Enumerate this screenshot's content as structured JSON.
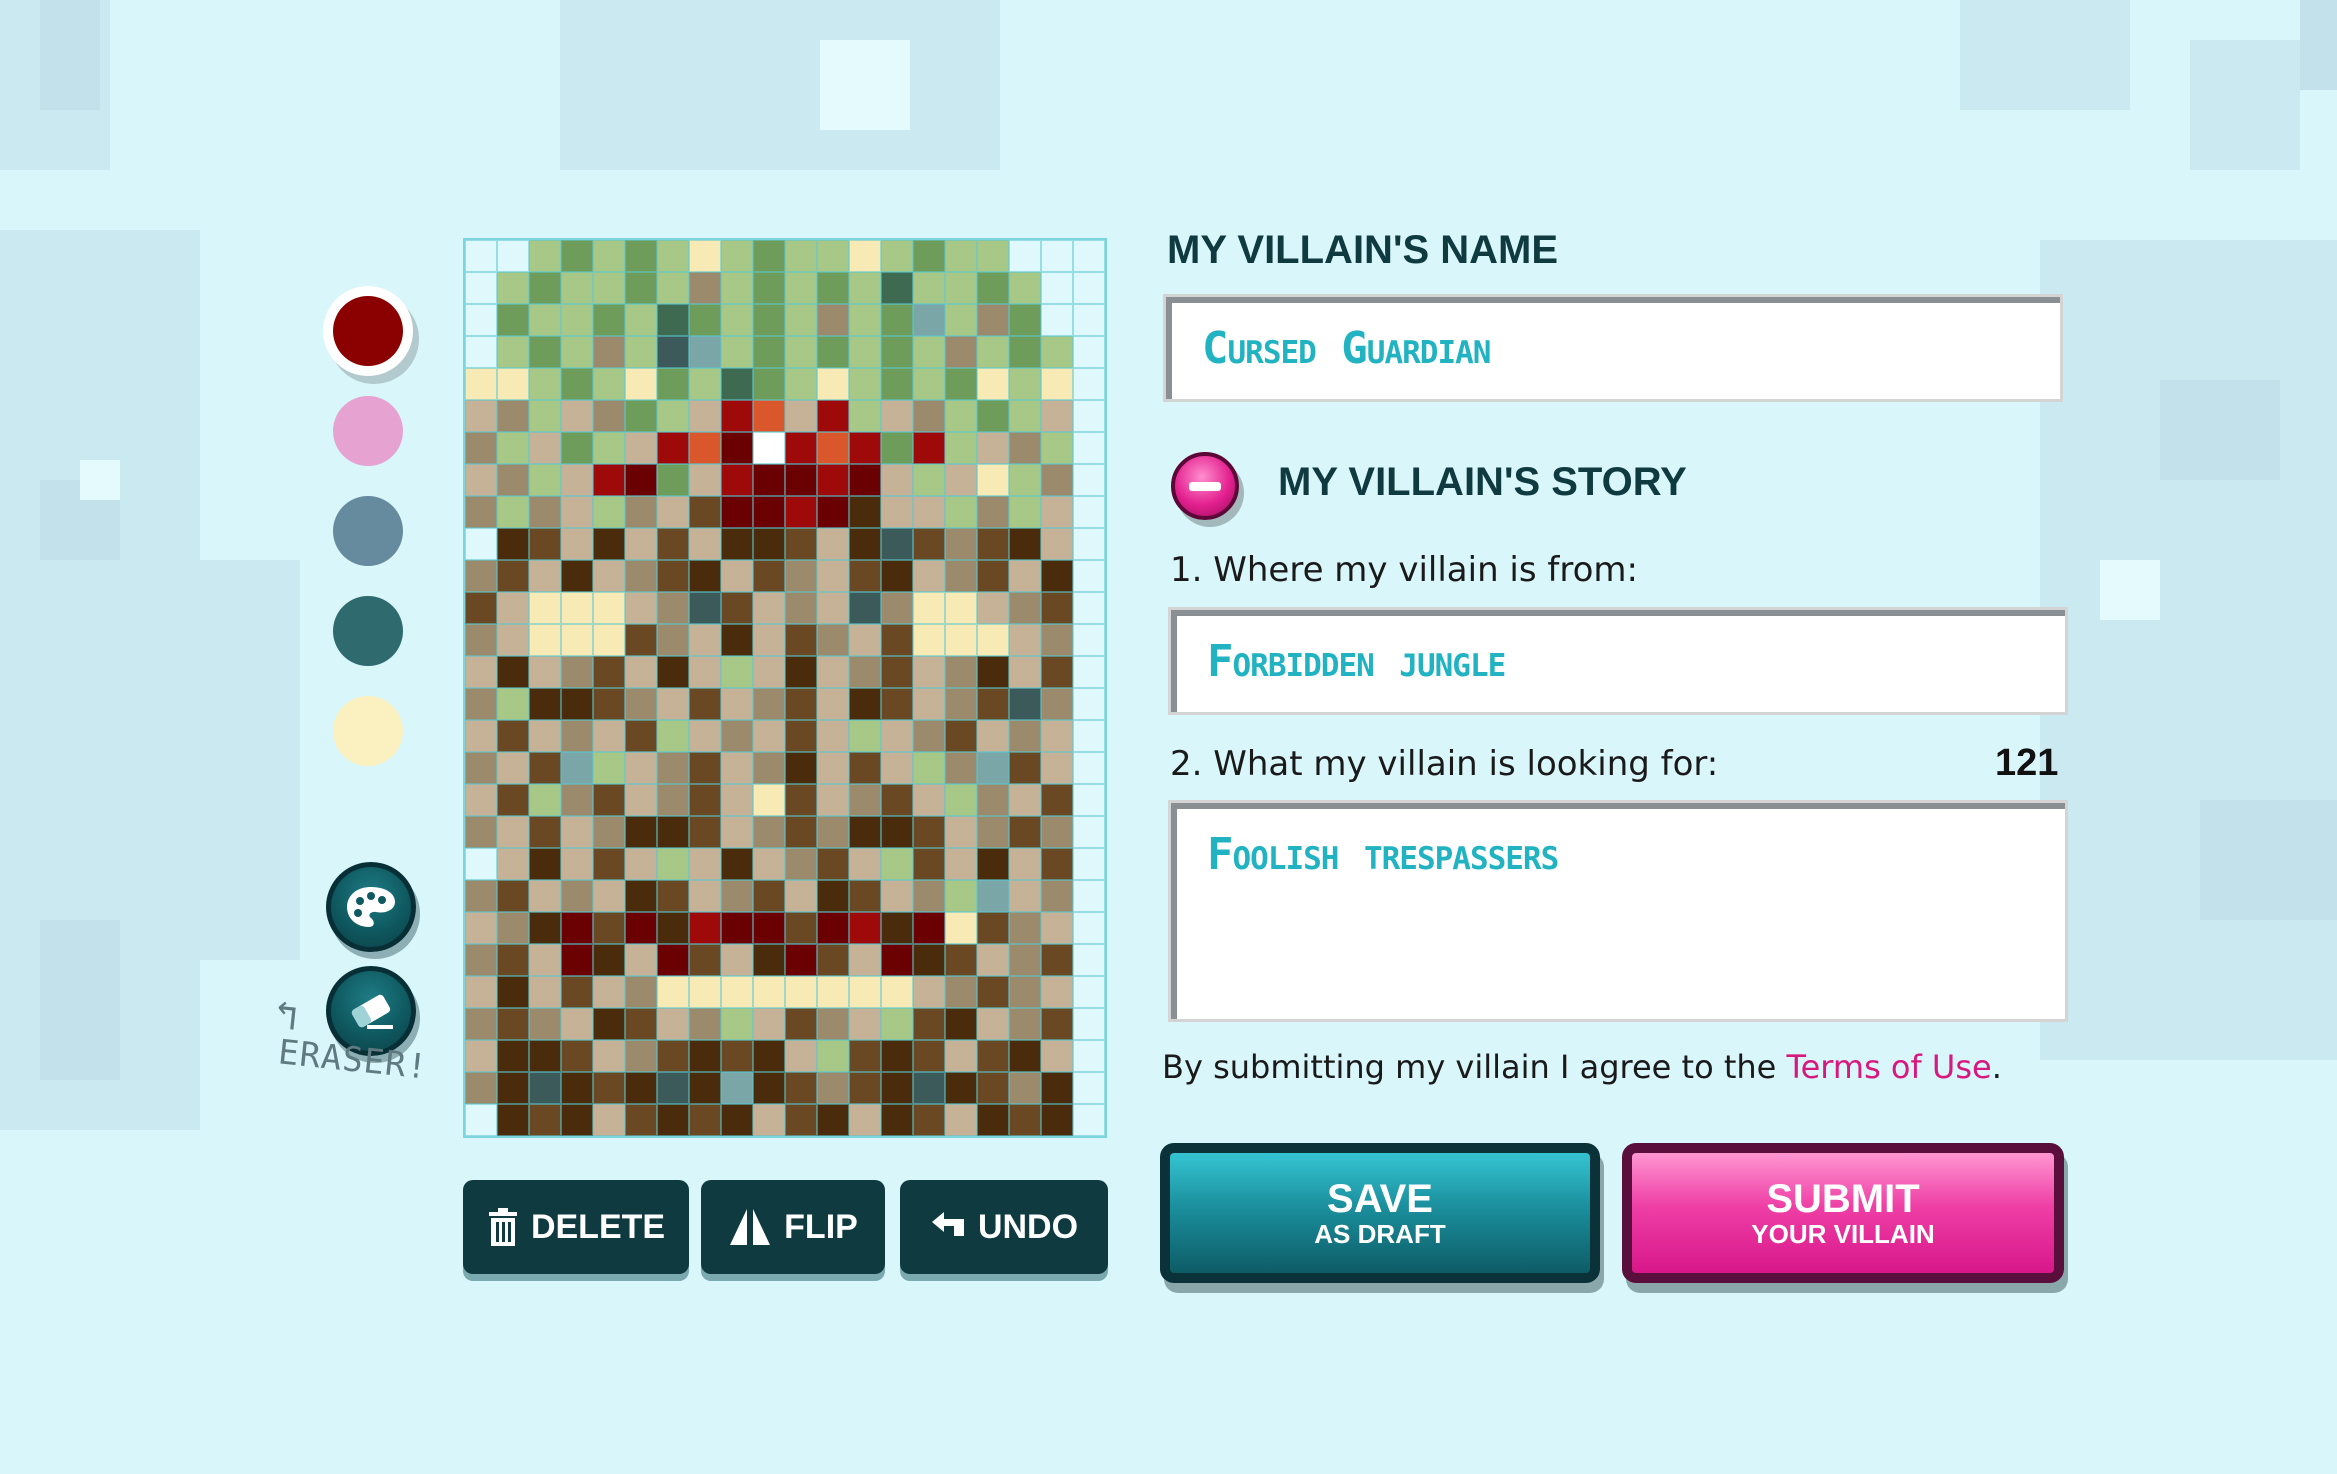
{
  "palette": {
    "colors": [
      "#8b0000",
      "#e6a3d1",
      "#668a9e",
      "#2e6a6e",
      "#fbf1c0"
    ],
    "selected_index": 0
  },
  "tools": {
    "palette_icon": "palette-icon",
    "eraser_icon": "eraser-icon",
    "eraser_note": "ERASER!"
  },
  "grid": {
    "cols": 20,
    "rows": 28,
    "legend": {
      ".": "#dff8fb",
      "g": "#a8c888",
      "G": "#6e9c5a",
      "k": "#3f6a52",
      "c": "#f8eab4",
      "t": "#c6b296",
      "T": "#9c8a6c",
      "d": "#6a4824",
      "D": "#4a2c0c",
      "r": "#9e0a0a",
      "R": "#6b0000",
      "o": "#d9572a",
      "w": "#ffffff",
      "s": "#7aa6a8",
      "n": "#3c5a5a"
    },
    "rows_data": [
      "..gGgGgcgGggcgGgg...",
      ".gGggGgTgGgGgkggGg..",
      ".GggGgkGgGgTgGsgTG..",
      ".gGgTgnsgGgGgGgTgGg.",
      "ccgGgcGgkGgcgGgGcgc",
      "tTgtTGgtrotrgtTgGgt",
      "TgtGgtroRwrorGrgtTg",
      "tTgtrRGtrRRrRtgtcgT",
      "TgTtgTtdRRrRDttgTgt",
      ".DdtDtdtDDdtDndTdDt.",
      "TdtDtTdDtdTtdDtTdtD",
      "dtccctTndtTtnTcctTd",
      "TtcccdTtDtdTtdccctT",
      "tDtTdtDtgtDtTdtTDtd",
      "TgDDdTtdtTdtDdtTdnT",
      "tdtTtdgtTtdtgtTdtTt",
      "TtdsgtTdtTDtdtgTsdt",
      "tdgTdtTdtcdtTdtgTtd",
      "TtdtTDDdtTdTDDdtTdT",
      ".tDtdtgtDtTdtgdtDtd",
      "TdtTtDdtTdtDdtTgstT",
      "tTDRdRDrRRdRrDRcdTt",
      "TdtRDtRdtDRdtRDdtTd",
      "tDtdtTcccccccctTdTt",
      "TdTtDdtTgtdTtgdDtTd",
      "tDDdtTdDdDtgdDdtdDt",
      "TDnDdDnDsDdTdDnDdTD",
      ".DdDtdDdDtdDtDdtDdD."
    ]
  },
  "actions": {
    "delete_label": "DELETE",
    "flip_label": "FLIP",
    "undo_label": "UNDO"
  },
  "form": {
    "name_label": "MY VILLAIN'S NAME",
    "name_value": "Cursed Guardian",
    "story_label": "MY VILLAIN'S STORY",
    "q1": "1. Where my villain is from:",
    "q1_value": "Forbidden jungle",
    "q2": "2. What my villain is looking for:",
    "q2_value": "Foolish trespassers",
    "q2_counter": "121",
    "terms_prefix": "By submitting my villain I agree to the ",
    "terms_link": "Terms of Use",
    "terms_suffix": "."
  },
  "buttons": {
    "save_line1": "SAVE",
    "save_line2": "AS DRAFT",
    "submit_line1": "SUBMIT",
    "submit_line2": "YOUR VILLAIN"
  }
}
